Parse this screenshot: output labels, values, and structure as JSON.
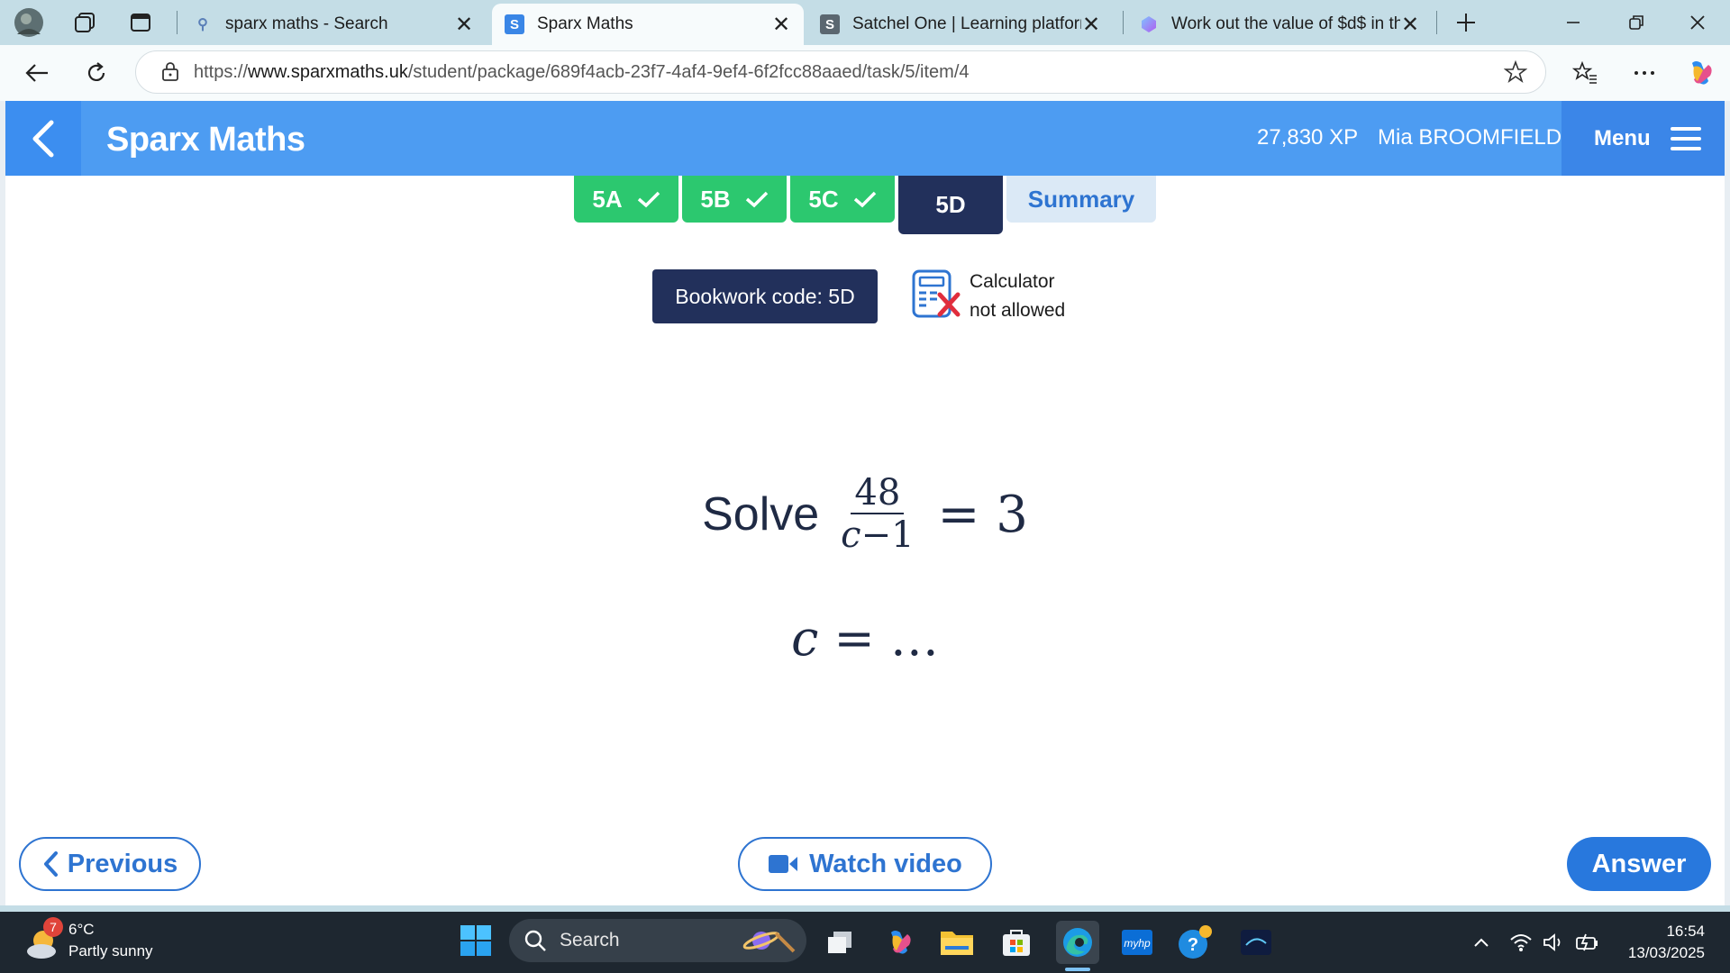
{
  "browser": {
    "tabs": [
      {
        "title": "sparx maths - Search",
        "icon": "search-icon"
      },
      {
        "title": "Sparx Maths",
        "icon": "sparx-favicon",
        "favicon_letter": "S"
      },
      {
        "title": "Satchel One | Learning platform",
        "icon": "satchel-favicon",
        "favicon_letter": "S"
      },
      {
        "title": "Work out the value of $d$ in this",
        "icon": "copilot-favicon"
      }
    ],
    "url_prefix": "https://",
    "url_host": "www.sparxmaths.uk",
    "url_path": "/student/package/689f4acb-23f7-4af4-9ef4-6f2fcc88aaed/task/5/item/4"
  },
  "app": {
    "brand": "Sparx Maths",
    "xp": "27,830 XP",
    "user": "Mia BROOMFIELD",
    "menu_label": "Menu",
    "task_tabs": [
      {
        "label": "5A",
        "state": "done"
      },
      {
        "label": "5B",
        "state": "done"
      },
      {
        "label": "5C",
        "state": "done"
      },
      {
        "label": "5D",
        "state": "current"
      },
      {
        "label": "Summary",
        "state": "summary"
      }
    ],
    "bookwork": "Bookwork code: 5D",
    "calculator_line1": "Calculator",
    "calculator_line2": "not allowed",
    "question": {
      "word": "Solve",
      "numerator": "48",
      "denominator_var": "c",
      "denominator_op": "−1",
      "equals": "= 3"
    },
    "answer_var": "c",
    "answer_rest": " = …",
    "buttons": {
      "previous": "Previous",
      "watch": "Watch video",
      "answer": "Answer"
    },
    "colors": {
      "header": "#4d9cf2",
      "done": "#2cc86f",
      "navy": "#22305b",
      "accent": "#2e74d1"
    }
  },
  "taskbar": {
    "weather_badge": "7",
    "temp": "6°C",
    "condition": "Partly sunny",
    "search_label": "Search",
    "time": "16:54",
    "date": "13/03/2025"
  }
}
